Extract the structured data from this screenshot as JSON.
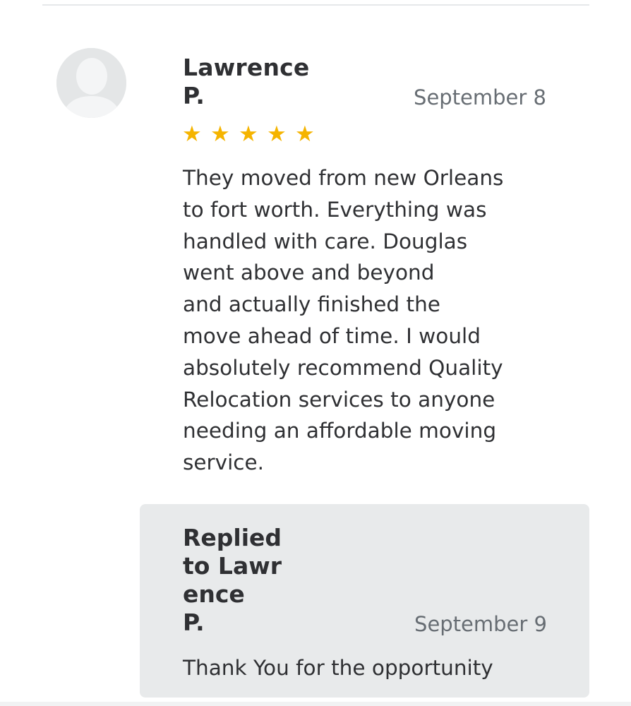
{
  "review": {
    "reviewer_name": "Lawrence\nP.",
    "date": "September 8",
    "rating": 5,
    "rating_max": 5,
    "star_color": "#f5b400",
    "text": "They moved from new Orleans\nto fort worth. Everything was\nhandled with care. Douglas\nwent above and beyond\nand actually finished the\nmove ahead of time. I would\nabsolutely recommend Quality\nRelocation services to anyone\nneeding an affordable moving\nservice."
  },
  "reply": {
    "title": "Replied\nto Lawr\nence\nP.",
    "date": "September 9",
    "text": "Thank You for the opportunity"
  },
  "avatar": {
    "icon": "default-user-avatar-icon"
  }
}
